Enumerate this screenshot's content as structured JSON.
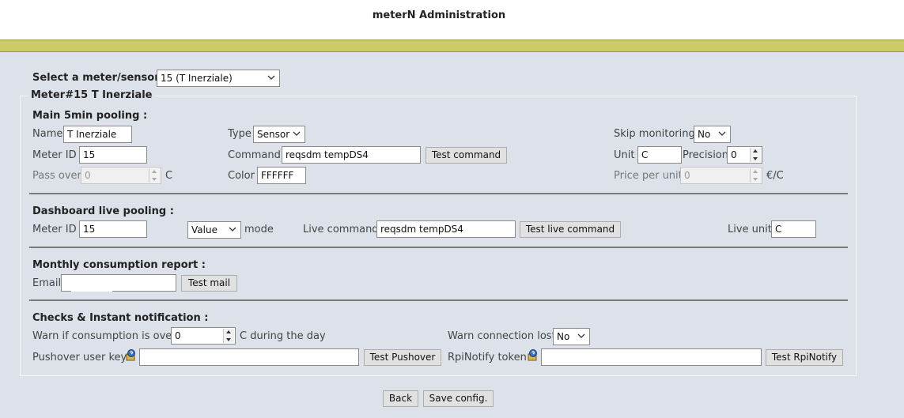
{
  "header": {
    "title": "meterN Administration"
  },
  "meter_select": {
    "label": "Select a meter/sensor :",
    "value": "15 (T Inerziale)"
  },
  "meter_legend": "Meter#15 T Inerziale",
  "main": {
    "heading": "Main 5min pooling :",
    "name_label": "Name",
    "name_value": "T Inerziale",
    "type_label": "Type",
    "type_value": "Sensor",
    "skip_label": "Skip monitoring",
    "skip_value": "No",
    "meter_id_label": "Meter ID",
    "meter_id_value": "15",
    "command_label": "Command",
    "command_value": "reqsdm tempDS4",
    "test_command_label": "Test command",
    "unit_label": "Unit",
    "unit_value": "C",
    "precision_label": "Precision",
    "precision_value": "0",
    "pass_over_label": "Pass over",
    "pass_over_value": "0",
    "pass_over_unit": "C",
    "color_label": "Color",
    "color_value": "FFFFFF",
    "price_label": "Price per unit",
    "price_value": "0",
    "price_unit": "€/C"
  },
  "live": {
    "heading": "Dashboard live pooling :",
    "meter_id_label": "Meter ID",
    "meter_id_value": "15",
    "mode_value": "Value",
    "mode_label": "mode",
    "command_label": "Live command",
    "command_value": "reqsdm tempDS4",
    "test_label": "Test live command",
    "unit_label": "Live unit",
    "unit_value": "C"
  },
  "report": {
    "heading": "Monthly consumption report :",
    "email_label": "Email",
    "email_value": "",
    "test_mail_label": "Test mail"
  },
  "checks": {
    "heading": "Checks & Instant notification :",
    "warn_label": "Warn if consumption is over",
    "warn_value": "0",
    "warn_suffix": "C during the day",
    "conn_label": "Warn connection lost",
    "conn_value": "No",
    "pushover_label": "Pushover user key",
    "pushover_value": "",
    "test_pushover_label": "Test Pushover",
    "rpi_label": "RpiNotify token",
    "rpi_value": "",
    "test_rpi_label": "Test RpiNotify"
  },
  "footer": {
    "back_label": "Back",
    "save_label": "Save config."
  },
  "colors": {
    "background": "#dde2ea",
    "accent_bar": "#cccc66",
    "header_bg": "#ffffff"
  },
  "icons": [
    "chevron-down-icon",
    "help-icon",
    "spinner-icon"
  ]
}
